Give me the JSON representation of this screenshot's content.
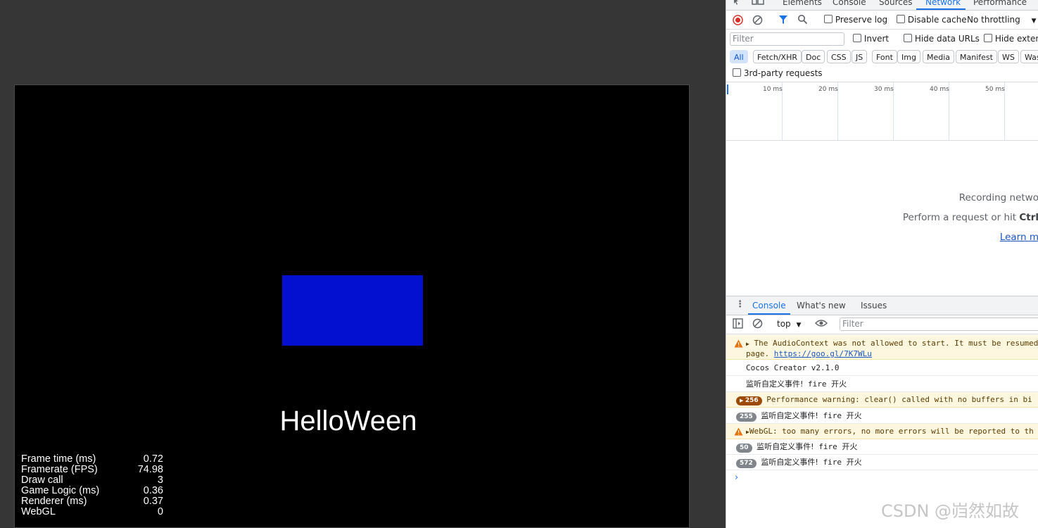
{
  "game": {
    "title_text": "HelloWeen",
    "colors": {
      "rect": "#0410cf",
      "background": "#000000"
    },
    "stats": [
      {
        "label": "Frame time (ms)",
        "value": "0.72"
      },
      {
        "label": "Framerate (FPS)",
        "value": "74.98"
      },
      {
        "label": "Draw call",
        "value": "3"
      },
      {
        "label": "Game Logic (ms)",
        "value": "0.36"
      },
      {
        "label": "Renderer (ms)",
        "value": "0.37"
      },
      {
        "label": "WebGL",
        "value": "0"
      }
    ]
  },
  "devtools": {
    "top_tabs": [
      "Elements",
      "Console",
      "Sources",
      "Network",
      "Performance"
    ],
    "active_tab": "Network",
    "network": {
      "toolbar": {
        "preserve_log": "Preserve log",
        "disable_cache": "Disable cache",
        "throttling": "No throttling"
      },
      "filter_placeholder": "Filter",
      "invert": "Invert",
      "hide_data_urls": "Hide data URLs",
      "hide_extensions": "Hide extens",
      "type_chips": [
        "All",
        "Fetch/XHR",
        "Doc",
        "CSS",
        "JS",
        "Font",
        "Img",
        "Media",
        "Manifest",
        "WS",
        "Was"
      ],
      "third_party": "3rd-party requests",
      "timeline_ticks": [
        "10 ms",
        "20 ms",
        "30 ms",
        "40 ms",
        "50 ms"
      ],
      "empty_line1": "Recording netwo",
      "empty_line2_prefix": "Perform a request or hit ",
      "empty_line2_key": "Ctrl",
      "learn_more": "Learn m"
    },
    "drawer": {
      "tabs": [
        "Console",
        "What's new",
        "Issues"
      ],
      "context": "top",
      "filter_placeholder": "Filter",
      "messages": [
        {
          "type": "warning",
          "text": "The AudioContext was not allowed to start. It must be resumed",
          "text2": "page.",
          "link": "https://goo.gl/7K7WLu"
        },
        {
          "type": "log",
          "text": "Cocos Creator v2.1.0"
        },
        {
          "type": "log",
          "text": "监听自定义事件!",
          "arg": "fire 开火"
        },
        {
          "type": "warning-count",
          "badge": "256",
          "text": "Performance warning: clear() called with no buffers in bi"
        },
        {
          "type": "log-count",
          "badge": "255",
          "text": "监听自定义事件!",
          "arg": "fire 开火"
        },
        {
          "type": "warning",
          "text": "WebGL: too many errors, no more errors will be reported to th"
        },
        {
          "type": "log-count",
          "badge": "50",
          "text": "监听自定义事件!",
          "arg": "fire 开火"
        },
        {
          "type": "log-count",
          "badge": "572",
          "text": "监听自定义事件!",
          "arg": "fire 开火"
        }
      ]
    }
  },
  "watermark": "CSDN @岿然如故"
}
